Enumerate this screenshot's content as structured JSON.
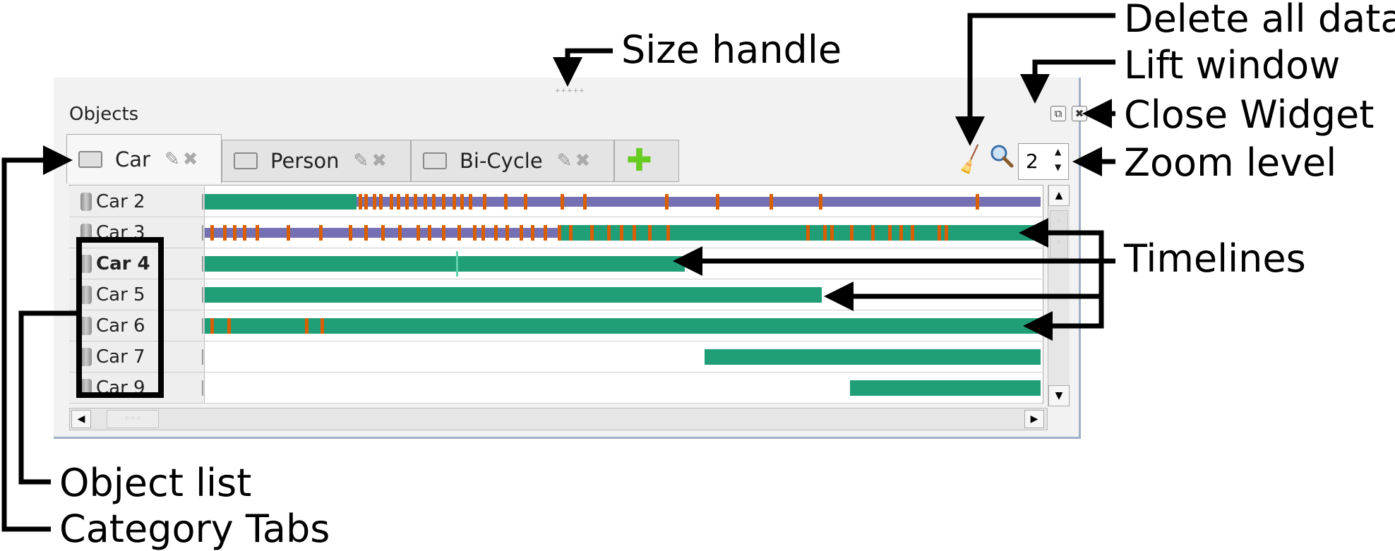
{
  "widget": {
    "title": "Objects",
    "size_handle": "+++++",
    "lift_window_glyph": "⧉",
    "close_glyph": "✖"
  },
  "tabs": [
    {
      "label": "Car",
      "active": true
    },
    {
      "label": "Person",
      "active": false
    },
    {
      "label": "Bi-Cycle",
      "active": false
    }
  ],
  "add_tab_glyph": "✚",
  "zoom": {
    "value": "2"
  },
  "objects": [
    {
      "label": "Car 2",
      "bold": false
    },
    {
      "label": "Car 3",
      "bold": false
    },
    {
      "label": "Car 4",
      "bold": true
    },
    {
      "label": "Car 5",
      "bold": false
    },
    {
      "label": "Car 6",
      "bold": false
    },
    {
      "label": "Car 7",
      "bold": false
    },
    {
      "label": "Car 9",
      "bold": false
    }
  ],
  "colors": {
    "bar_green": "#1f9e77",
    "bar_purple": "#7570b3",
    "marker_orange": "#d95f02",
    "cursor_teal": "#5fd3b0"
  },
  "icons": {
    "broom": "broom-icon",
    "zoom": "magnifier-icon",
    "add": "plus-icon",
    "category": "book-icon",
    "edit": "pencil-icon",
    "delete": "delete-icon",
    "object": "cylinder-icon"
  },
  "annotations": {
    "size_handle": "Size handle",
    "delete_all_data": "Delete all data",
    "lift_window": "Lift window",
    "close_widget": "Close Widget",
    "zoom_level": "Zoom level",
    "timelines": "Timelines",
    "object_list": "Object list",
    "category_tabs": "Category Tabs"
  }
}
